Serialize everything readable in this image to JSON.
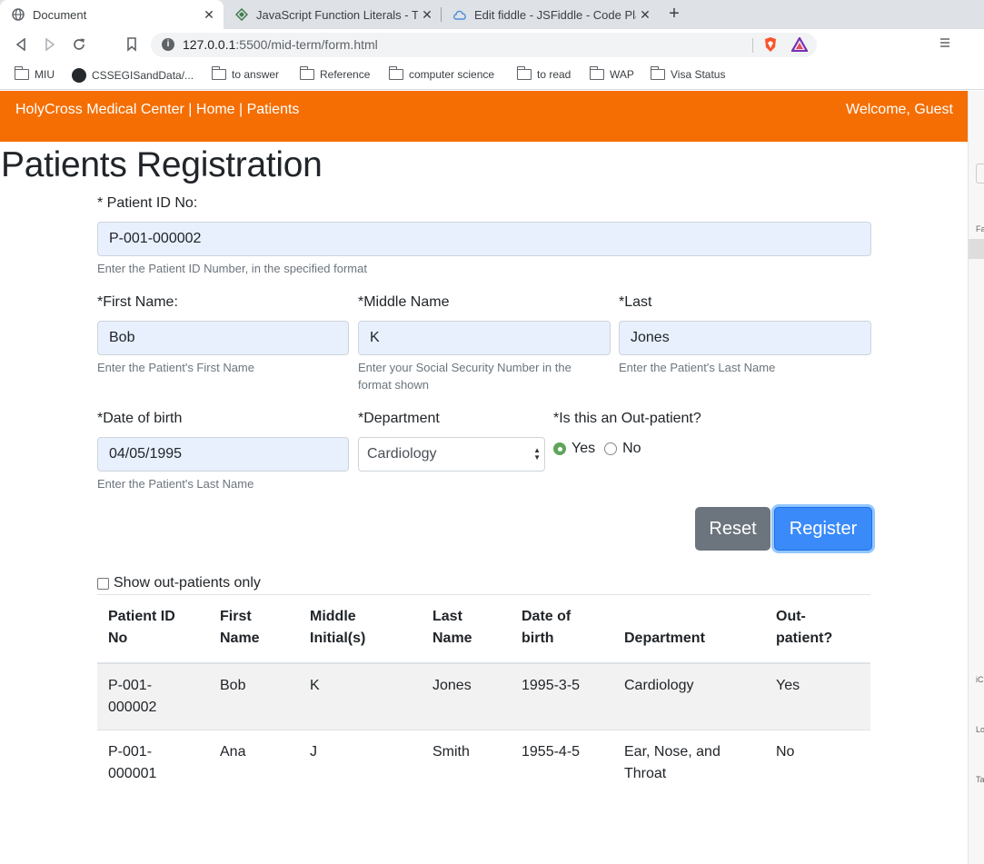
{
  "browser": {
    "tabs": [
      {
        "title": "Document",
        "icon": "globe-icon",
        "active": true
      },
      {
        "title": "JavaScript Function Literals - Tu",
        "icon": "tutorial-diamond-icon",
        "active": false
      },
      {
        "title": "Edit fiddle - JSFiddle - Code Pla",
        "icon": "jsfiddle-cloud-icon",
        "active": false
      }
    ],
    "close_glyph": "✕",
    "new_tab_glyph": "+",
    "url_host": "127.0.0.1",
    "url_rest": ":5500/mid-term/form.html",
    "bookmarks": [
      {
        "label": "MIU",
        "icon": "folder-icon"
      },
      {
        "label": "CSSEGISandData/...",
        "icon": "github-icon"
      },
      {
        "label": "to answer",
        "icon": "folder-icon"
      },
      {
        "label": "Reference",
        "icon": "folder-icon"
      },
      {
        "label": "computer science",
        "icon": "folder-icon"
      },
      {
        "label": "to read",
        "icon": "folder-icon"
      },
      {
        "label": "WAP",
        "icon": "folder-icon"
      },
      {
        "label": "Visa Status",
        "icon": "folder-icon"
      }
    ],
    "side_fragments": [
      "Fa",
      "iC",
      "Lo",
      "Ta"
    ]
  },
  "navbar": {
    "brand": "HolyCross Medical Center | Home | Patients",
    "welcome": "Welcome, Guest",
    "color": "#f56e03"
  },
  "page_title": "Patients Registration",
  "form": {
    "patient_id": {
      "label": "* Patient ID No:",
      "value": "P-001-000002",
      "help": "Enter the Patient ID Number, in the specified format"
    },
    "first_name": {
      "label": "*First Name:",
      "value": "Bob",
      "help": "Enter the Patient's First Name"
    },
    "middle_name": {
      "label": "*Middle Name",
      "value": "K",
      "help_line1": "Enter your Social Security Number in the",
      "help_line2": "format shown"
    },
    "last_name": {
      "label": "*Last",
      "value": "Jones",
      "help": "Enter the Patient's Last Name"
    },
    "dob": {
      "label": "*Date of birth",
      "value": "04/05/1995",
      "help": "Enter the Patient's Last Name"
    },
    "department": {
      "label": "*Department",
      "value": "Cardiology"
    },
    "outpatient": {
      "label": "*Is this an Out-patient?",
      "options": [
        "Yes",
        "No"
      ],
      "selected": "Yes"
    },
    "reset_label": "Reset",
    "register_label": "Register"
  },
  "filter": {
    "label": "Show out-patients only",
    "checked": false
  },
  "table": {
    "headers": [
      {
        "l1": "Patient ID",
        "l2": "No"
      },
      {
        "l1": "First",
        "l2": "Name"
      },
      {
        "l1": "Middle",
        "l2": "Initial(s)"
      },
      {
        "l1": "Last",
        "l2": "Name"
      },
      {
        "l1": "Date of",
        "l2": "birth"
      },
      {
        "l1": "",
        "l2": "Department"
      },
      {
        "l1": "Out-",
        "l2": "patient?"
      }
    ],
    "rows": [
      {
        "id_l1": "P-001-",
        "id_l2": "000002",
        "first": "Bob",
        "middle": "K",
        "last": "Jones",
        "dob": "1995-3-5",
        "dept_l1": "Cardiology",
        "dept_l2": "",
        "outpatient": "Yes"
      },
      {
        "id_l1": "P-001-",
        "id_l2": "000001",
        "first": "Ana",
        "middle": "J",
        "last": "Smith",
        "dob": "1955-4-5",
        "dept_l1": "Ear, Nose, and",
        "dept_l2": "Throat",
        "outpatient": "No"
      }
    ]
  }
}
